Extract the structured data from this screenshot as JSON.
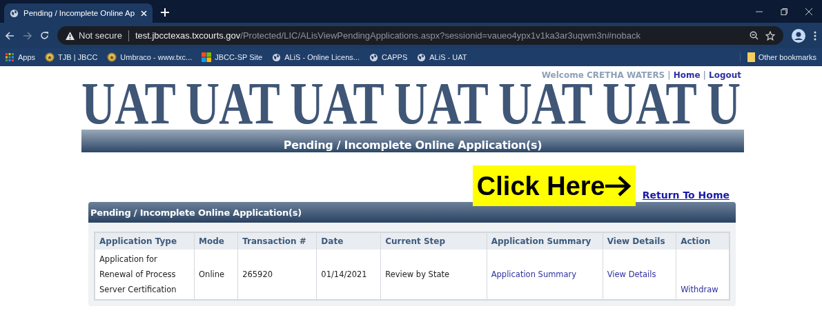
{
  "browser": {
    "tab_title": "Pending / Incomplete Online Ap",
    "security": "Not secure",
    "url_host": "test.jbcctexas.txcourts.gov",
    "url_path": "/Protected/LIC/ALisViewPendingApplications.aspx?sessionid=vaueo4ypx1v1ka3ar3uqwm3n#noback",
    "bookmarks": [
      {
        "label": "Apps",
        "kind": "apps"
      },
      {
        "label": "TJB | JBCC",
        "kind": "seal"
      },
      {
        "label": "Umbraco - www.txc...",
        "kind": "seal"
      },
      {
        "label": "JBCC-SP Site",
        "kind": "tiles"
      },
      {
        "label": "ALiS - Online Licens...",
        "kind": "globe"
      },
      {
        "label": "CAPPS",
        "kind": "globe"
      },
      {
        "label": "ALiS - UAT",
        "kind": "globe"
      }
    ],
    "other_bookmarks": "Other bookmarks"
  },
  "page": {
    "banner": "UAT UAT UAT UAT UAT UAT U",
    "user_links": [
      "Welcome CRETHA WATERS",
      "|",
      "Home",
      "|",
      "Logout"
    ],
    "title": "Pending / Incomplete Online Application(s)",
    "callout": "Click Here",
    "return_link": "Return To Home",
    "panel": {
      "title": "Pending / Incomplete Online Application(s)",
      "columns": [
        "Application Type",
        "Mode",
        "Transaction #",
        "Date",
        "Current Step",
        "Application Summary",
        "View Details",
        "Action"
      ],
      "rows": [
        {
          "cells": [
            {
              "kind": "text",
              "text": "Application for Renewal of Process Server Certification"
            },
            {
              "kind": "text",
              "text": "Online"
            },
            {
              "kind": "text",
              "text": "265920"
            },
            {
              "kind": "text",
              "text": "01/14/2021"
            },
            {
              "kind": "text",
              "text": "Review by State"
            },
            {
              "kind": "link",
              "text": "Application Summary"
            },
            {
              "kind": "link",
              "text": "View Details"
            },
            {
              "kind": "bottomlink",
              "text": "Withdraw"
            }
          ]
        }
      ]
    }
  }
}
